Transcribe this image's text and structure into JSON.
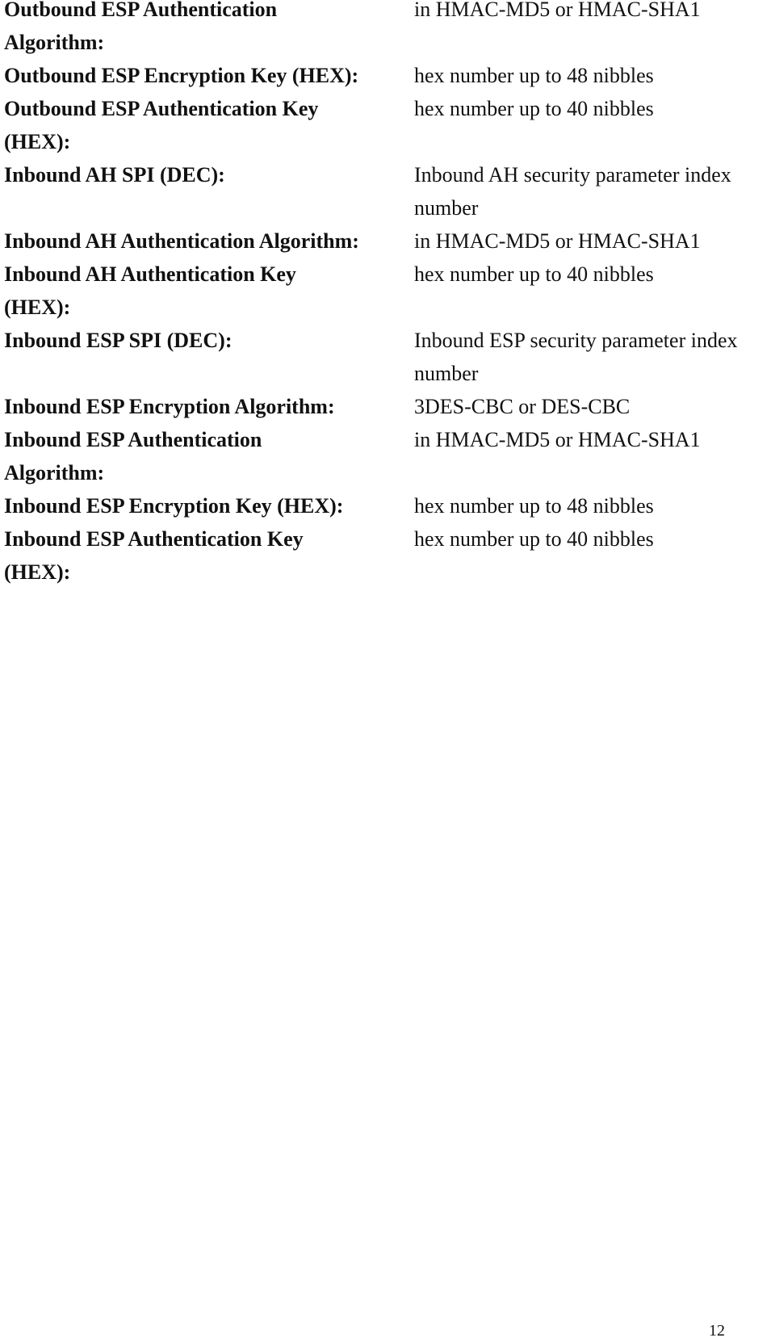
{
  "document": {
    "rows": [
      {
        "label_lines": [
          "Outbound ESP Authentication",
          "Algorithm:"
        ],
        "value_lines": [
          "in HMAC-MD5 or HMAC-SHA1"
        ]
      },
      {
        "label_lines": [
          "Outbound ESP Encryption Key (HEX):"
        ],
        "value_lines": [
          "hex number up to 48 nibbles"
        ]
      },
      {
        "label_lines": [
          "Outbound ESP Authentication Key",
          "(HEX):"
        ],
        "value_lines": [
          "hex number up to 40 nibbles"
        ]
      },
      {
        "label_lines": [
          "Inbound AH SPI (DEC):"
        ],
        "value_lines": [
          "Inbound AH security parameter index",
          "number"
        ]
      },
      {
        "label_lines": [
          "Inbound AH Authentication Algorithm:"
        ],
        "value_lines": [
          "in HMAC-MD5 or HMAC-SHA1"
        ]
      },
      {
        "label_lines": [
          "Inbound AH Authentication Key",
          "(HEX):"
        ],
        "value_lines": [
          "hex number up to 40 nibbles"
        ]
      },
      {
        "label_lines": [
          "Inbound ESP SPI (DEC):"
        ],
        "value_lines": [
          "Inbound ESP security parameter index",
          "number"
        ]
      },
      {
        "label_lines": [
          "Inbound ESP Encryption Algorithm:"
        ],
        "value_lines": [
          "3DES-CBC or DES-CBC"
        ]
      },
      {
        "label_lines": [
          "Inbound ESP Authentication",
          "Algorithm:"
        ],
        "value_lines": [
          "in HMAC-MD5 or HMAC-SHA1"
        ]
      },
      {
        "label_lines": [
          "Inbound ESP Encryption Key (HEX):"
        ],
        "value_lines": [
          "hex number up to 48 nibbles"
        ]
      },
      {
        "label_lines": [
          "Inbound ESP Authentication Key",
          "(HEX):"
        ],
        "value_lines": [
          "hex number up to 40 nibbles"
        ]
      }
    ],
    "page_number": "12"
  }
}
